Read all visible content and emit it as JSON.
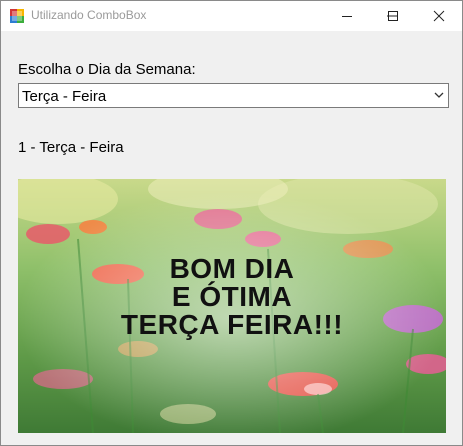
{
  "window": {
    "title": "Utilizando ComboBox"
  },
  "form": {
    "label": "Escolha o Dia da Semana:",
    "combo": {
      "selected": "Terça - Feira"
    },
    "result": "1 - Terça - Feira"
  },
  "picture": {
    "lines": [
      "BOM DIA",
      "E ÓTIMA",
      "TERÇA FEIRA!!!"
    ]
  },
  "icons": {
    "app": "app-form-icon",
    "minimize": "minimize-icon",
    "maximize": "maximize-icon",
    "close": "close-icon",
    "dropdown": "chevron-down-icon"
  }
}
